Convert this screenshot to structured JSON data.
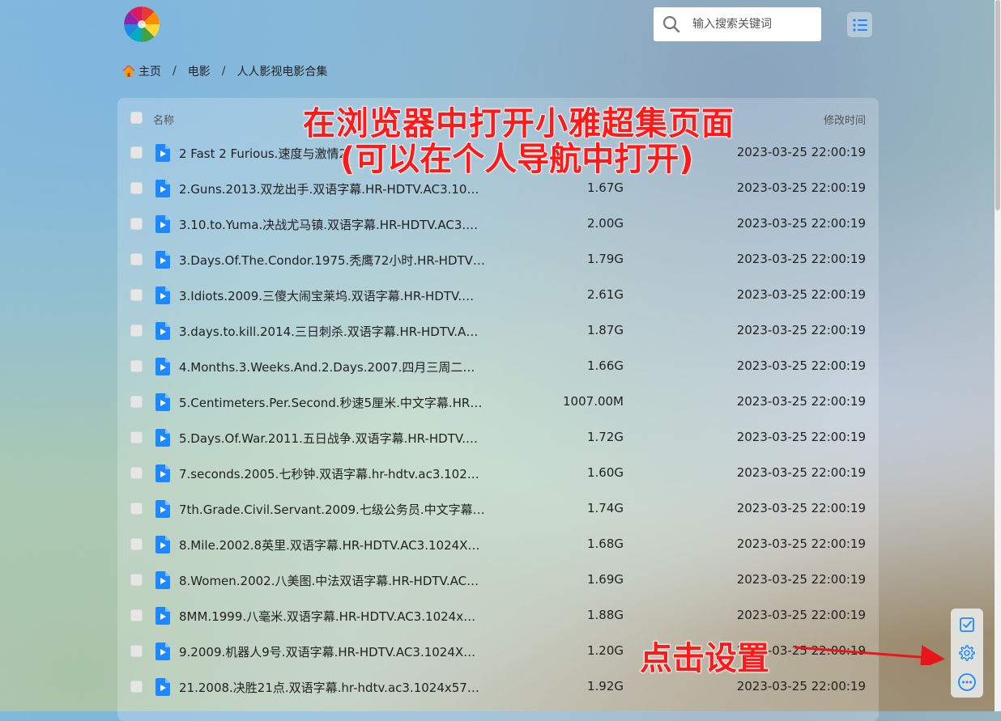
{
  "header": {
    "search": {
      "placeholder": "输入搜索关键词"
    }
  },
  "breadcrumb": {
    "home": "主页",
    "separator": "/",
    "items": [
      "电影",
      "人人影视电影合集"
    ]
  },
  "table": {
    "columns": {
      "name": "名称",
      "modified": "修改时间"
    },
    "rows": [
      {
        "name": "2 Fast 2 Furious.速度与激情2",
        "size": "",
        "modified": "2023-03-25 22:00:19"
      },
      {
        "name": "2.Guns.2013.双龙出手.双语字幕.HR-HDTV.AC3.10…",
        "size": "1.67G",
        "modified": "2023-03-25 22:00:19"
      },
      {
        "name": "3.10.to.Yuma.决战尤马镇.双语字幕.HR-HDTV.AC3.…",
        "size": "2.00G",
        "modified": "2023-03-25 22:00:19"
      },
      {
        "name": "3.Days.Of.The.Condor.1975.秃鹰72小时.HR-HDTV…",
        "size": "1.79G",
        "modified": "2023-03-25 22:00:19"
      },
      {
        "name": "3.Idiots.2009.三傻大闹宝莱坞.双语字幕.HR-HDTV.…",
        "size": "2.61G",
        "modified": "2023-03-25 22:00:19"
      },
      {
        "name": "3.days.to.kill.2014.三日刺杀.双语字幕.HR-HDTV.A…",
        "size": "1.87G",
        "modified": "2023-03-25 22:00:19"
      },
      {
        "name": "4.Months.3.Weeks.And.2.Days.2007.四月三周二…",
        "size": "1.66G",
        "modified": "2023-03-25 22:00:19"
      },
      {
        "name": "5.Centimeters.Per.Second.秒速5厘米.中文字幕.HR…",
        "size": "1007.00M",
        "modified": "2023-03-25 22:00:19"
      },
      {
        "name": "5.Days.Of.War.2011.五日战争.双语字幕.HR-HDTV.…",
        "size": "1.72G",
        "modified": "2023-03-25 22:00:19"
      },
      {
        "name": "7.seconds.2005.七秒钟.双语字幕.hr-hdtv.ac3.102…",
        "size": "1.60G",
        "modified": "2023-03-25 22:00:19"
      },
      {
        "name": "7th.Grade.Civil.Servant.2009.七级公务员.中文字幕…",
        "size": "1.74G",
        "modified": "2023-03-25 22:00:19"
      },
      {
        "name": "8.Mile.2002.8英里.双语字幕.HR-HDTV.AC3.1024X…",
        "size": "1.68G",
        "modified": "2023-03-25 22:00:19"
      },
      {
        "name": "8.Women.2002.八美图.中法双语字幕.HR-HDTV.AC…",
        "size": "1.69G",
        "modified": "2023-03-25 22:00:19"
      },
      {
        "name": "8MM.1999.八毫米.双语字幕.HR-HDTV.AC3.1024x…",
        "size": "1.88G",
        "modified": "2023-03-25 22:00:19"
      },
      {
        "name": "9.2009.机器人9号.双语字幕.HR-HDTV.AC3.1024X…",
        "size": "1.20G",
        "modified": "2023-03-25 22:00:19"
      },
      {
        "name": "21.2008.决胜21点.双语字幕.hr-hdtv.ac3.1024x57…",
        "size": "1.92G",
        "modified": "2023-03-25 22:00:19"
      }
    ]
  },
  "annotations": {
    "top_line1": "在浏览器中打开小雅超集页面",
    "top_line2": "(可以在个人导航中打开)",
    "settings_hint": "点击设置"
  },
  "icons": {
    "logo": "colorful-pinwheel-logo",
    "search": "search-icon",
    "menu": "list-menu-icon",
    "home": "home-icon",
    "file": "video-file-icon",
    "select": "check-square-icon",
    "settings": "gear-icon",
    "more": "more-dots-icon"
  },
  "colors": {
    "accent": "#1e88ff",
    "annotation": "#ff1a1a"
  }
}
